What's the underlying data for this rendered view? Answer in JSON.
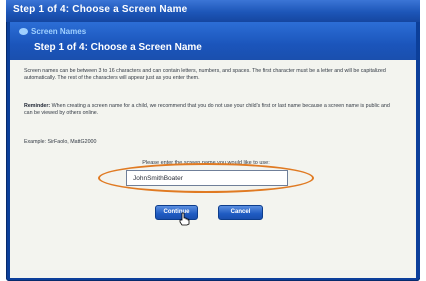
{
  "window": {
    "title": "Step 1 of 4: Choose a Screen Name"
  },
  "header": {
    "logo_text": "Screen Names",
    "step_title": "Step 1 of 4: Choose a Screen Name"
  },
  "content": {
    "para1": "Screen names can be between 3 to 16 characters and can contain letters, numbers, and spaces. The first character must be a letter and will be capitalized automatically. The rest of the characters will appear just as you enter them.",
    "para2_bold": "Reminder:",
    "para2": " When creating a screen name for a child, we recommend that you do not use your child's first or last name because a screen name is public and can be viewed by others online.",
    "example": "Example: SirFaolo, MattG2000",
    "prompt": "Please enter the screen name you would like to use:"
  },
  "form": {
    "screen_name_value": "JohnSmithBoater"
  },
  "buttons": {
    "continue_label": "Continue",
    "cancel_label": "Cancel"
  },
  "colors": {
    "title_bar": "#1d56b8",
    "header": "#1b55bb",
    "highlight_ellipse": "#e07a22",
    "button": "#1f5bc2"
  }
}
